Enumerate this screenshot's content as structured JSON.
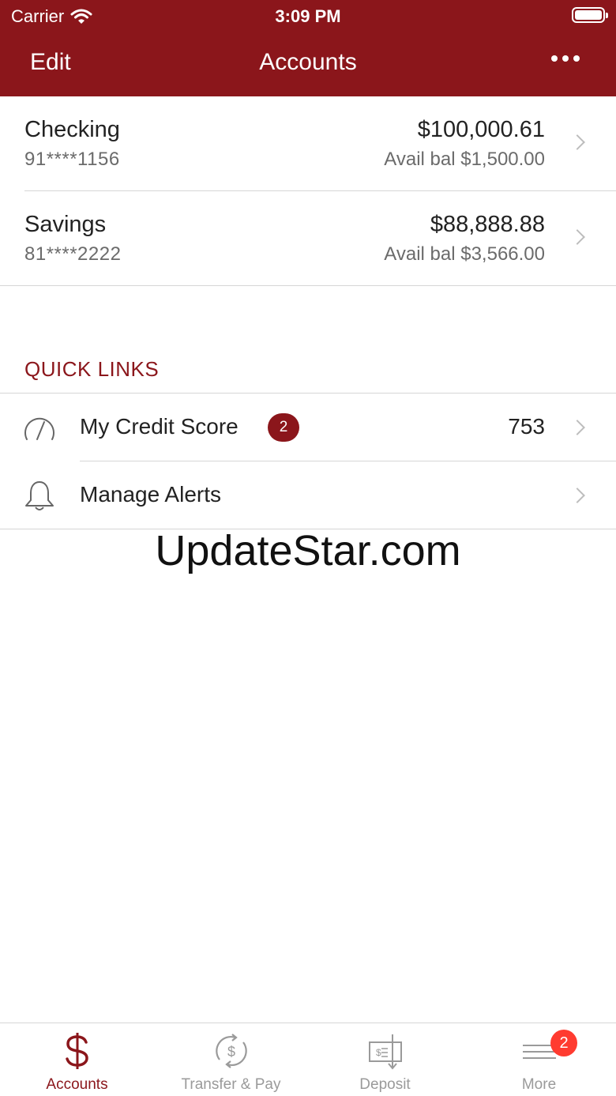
{
  "status_bar": {
    "carrier": "Carrier",
    "time": "3:09 PM"
  },
  "nav": {
    "edit_label": "Edit",
    "title": "Accounts"
  },
  "accounts": [
    {
      "name": "Checking",
      "number": "91****1156",
      "balance": "$100,000.61",
      "available": "Avail bal $1,500.00"
    },
    {
      "name": "Savings",
      "number": "81****2222",
      "balance": "$88,888.88",
      "available": "Avail bal $3,566.00"
    }
  ],
  "quick_links": {
    "title": "QUICK LINKS",
    "items": [
      {
        "label": "My Credit Score",
        "badge": "2",
        "value": "753",
        "icon": "gauge-icon"
      },
      {
        "label": "Manage Alerts",
        "icon": "bell-icon"
      }
    ]
  },
  "watermark": "UpdateStar.com",
  "tabs": [
    {
      "label": "Accounts",
      "icon": "dollar-icon",
      "active": true
    },
    {
      "label": "Transfer & Pay",
      "icon": "transfer-icon"
    },
    {
      "label": "Deposit",
      "icon": "check-deposit-icon"
    },
    {
      "label": "More",
      "icon": "menu-icon",
      "badge": "2"
    }
  ],
  "colors": {
    "brand": "#8b161b",
    "notification": "#ff3b30",
    "inactive": "#9a9a9a"
  }
}
